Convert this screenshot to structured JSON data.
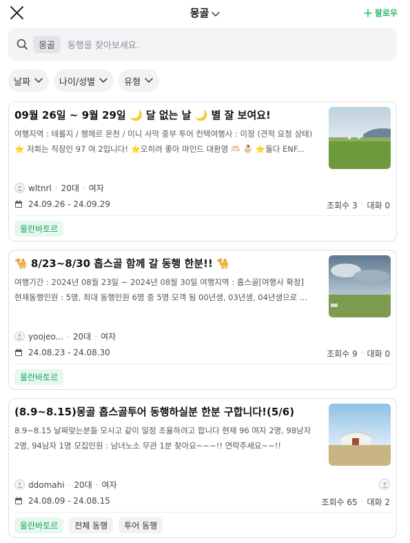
{
  "header": {
    "title": "몽골",
    "follow_label": "팔로우",
    "accent": "#1fb86a"
  },
  "search": {
    "chip": "몽골",
    "placeholder": "동행을 찾아보세요."
  },
  "filters": [
    {
      "label": "날짜"
    },
    {
      "label": "나이/성별"
    },
    {
      "label": "유형"
    }
  ],
  "posts": [
    {
      "title": "09월 26일 ~ 9월 29일 🌙 달 없는 날 🌙 별 잘 보여요!",
      "desc_line1": "여행지역 : 테를지 / 쳉헤르 온천 / 미니 사막 중부 투어 컨텍여행사 : 미정 (견적 요청 상태)",
      "desc_line2": "⭐ 저희는 직장인 97 여 2입니다! ⭐오히려 좋아 마인드 대환영 🫶🏻 👶🏻 ⭐둘다 ENF...",
      "user": "wltnrl",
      "age": "20대",
      "gender": "여자",
      "dates": "24.09.26 - 24.09.29",
      "views": "조회수 3",
      "chats": "대화 0",
      "tags": [
        "울란바토르"
      ]
    },
    {
      "title": "🐪 8/23~8/30 홉스골 함께 갈 동행 한분!! 🐪",
      "desc_line1": "여행기간 : 2024년 08월 23일 ~ 2024년 08월 30일 여행지역 : 홉스골[여행사 확정]",
      "desc_line2": "현재동행인원 : 5명, 최대 동행인원 6명 중 5명 모객 됨 00년생, 03년생, 04년생으로 ...",
      "user": "yoojeo...",
      "age": "20대",
      "gender": "여자",
      "dates": "24.08.23 - 24.08.30",
      "views": "조회수 9",
      "chats": "대화 0",
      "tags": [
        "울란바토르"
      ]
    },
    {
      "title": "(8.9~8.15)몽골 홉스골투어 동행하실분 한분 구합니다!(5/6)",
      "desc_line1": "8.9~8.15 날짜맞는분들 모시고 같이 일정 조율하려고 합니다 현재 96 여자 2명, 98남자",
      "desc_line2": "2명, 94남자 1명 모집인원 : 남녀노소 무관 1분 찾아요~~~!! 연락주세요~~!!",
      "user": "ddomahi",
      "age": "20대",
      "gender": "여자",
      "dates": "24.08.09 - 24.08.15",
      "views": "조회수 65",
      "chats": "대화 2",
      "tags": [
        "울란바토르",
        "전체 동행",
        "투어 동행"
      ]
    }
  ]
}
